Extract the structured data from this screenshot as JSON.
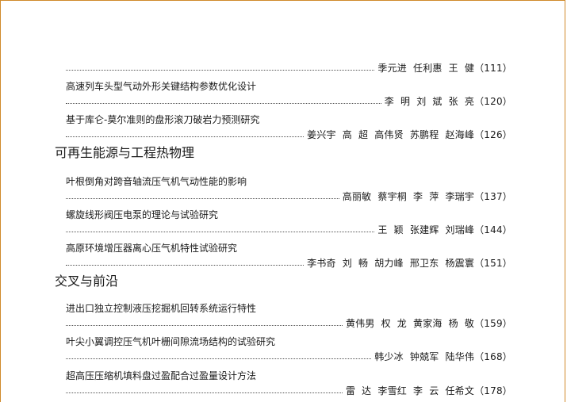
{
  "top_authors": "季元进  任利惠  王  健（111）",
  "entries_a": [
    {
      "title": "高速列车头型气动外形关键结构参数优化设计",
      "authors": "李  明  刘  斌  张  亮（120）"
    },
    {
      "title": "基于库仑-莫尔准则的盘形滚刀破岩力预测研究",
      "authors": "姜兴宇  高  超  高伟贤  苏鹏程  赵海峰（126）"
    }
  ],
  "section_1": "可再生能源与工程热物理",
  "entries_b": [
    {
      "title": "叶根倒角对跨音轴流压气机气动性能的影响",
      "authors": "高丽敏  蔡宇桐  李  萍  李瑞宇（137）"
    },
    {
      "title": "螺旋线形阀压电泵的理论与试验研究",
      "authors": "王  颖  张建辉  刘瑞峰（144）"
    },
    {
      "title": "高原环境增压器离心压气机特性试验研究",
      "authors": "李书奇  刘  畅  胡力峰  邢卫东  杨震寰（151）"
    }
  ],
  "section_2": "交叉与前沿",
  "entries_c": [
    {
      "title": "进出口独立控制液压挖掘机回转系统运行特性",
      "authors": "黄伟男  权  龙  黄家海  杨  敬（159）"
    },
    {
      "title": "叶尖小翼调控压气机叶栅间隙流场结构的试验研究",
      "authors": "韩少冰  钟兢军  陆华伟（168）"
    },
    {
      "title": "超高压压缩机填料盘过盈配合过盈量设计方法",
      "authors": "雷  达  李雪红  李  云  任希文（178）"
    }
  ]
}
